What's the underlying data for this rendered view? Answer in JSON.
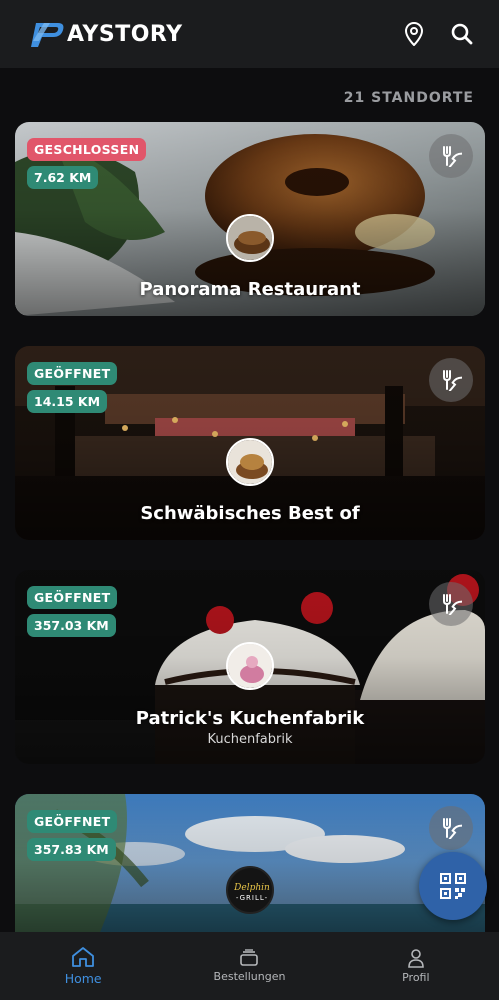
{
  "app": {
    "brand": "AYSTORY",
    "accent": "#3f8fdf"
  },
  "header": {
    "location_icon": "location-pin-icon",
    "search_icon": "search-icon"
  },
  "count_label": "21 STANDORTE",
  "restaurants": [
    {
      "name": "Panorama Restaurant",
      "subtitle": "",
      "status": "GESCHLOSSEN",
      "status_color": "#e1566a",
      "distance": "7.62 KM"
    },
    {
      "name": "Schwäbisches Best of",
      "subtitle": "",
      "status": "GEÖFFNET",
      "status_color": "#2f8a75",
      "distance": "14.15 KM"
    },
    {
      "name": "Patrick's Kuchenfabrik",
      "subtitle": "Kuchenfabrik",
      "status": "GEÖFFNET",
      "status_color": "#2f8a75",
      "distance": "357.03 KM"
    },
    {
      "name": "",
      "subtitle": "",
      "status": "GEÖFFNET",
      "status_color": "#2f8a75",
      "distance": "357.83 KM",
      "logo_text": "Delphin GRILL"
    }
  ],
  "fab": {
    "icon": "qr-code-icon"
  },
  "nav": [
    {
      "label": "Home",
      "icon": "home-icon",
      "active": true
    },
    {
      "label": "Bestellungen",
      "icon": "orders-icon",
      "active": false
    },
    {
      "label": "Profil",
      "icon": "profile-icon",
      "active": false
    }
  ]
}
